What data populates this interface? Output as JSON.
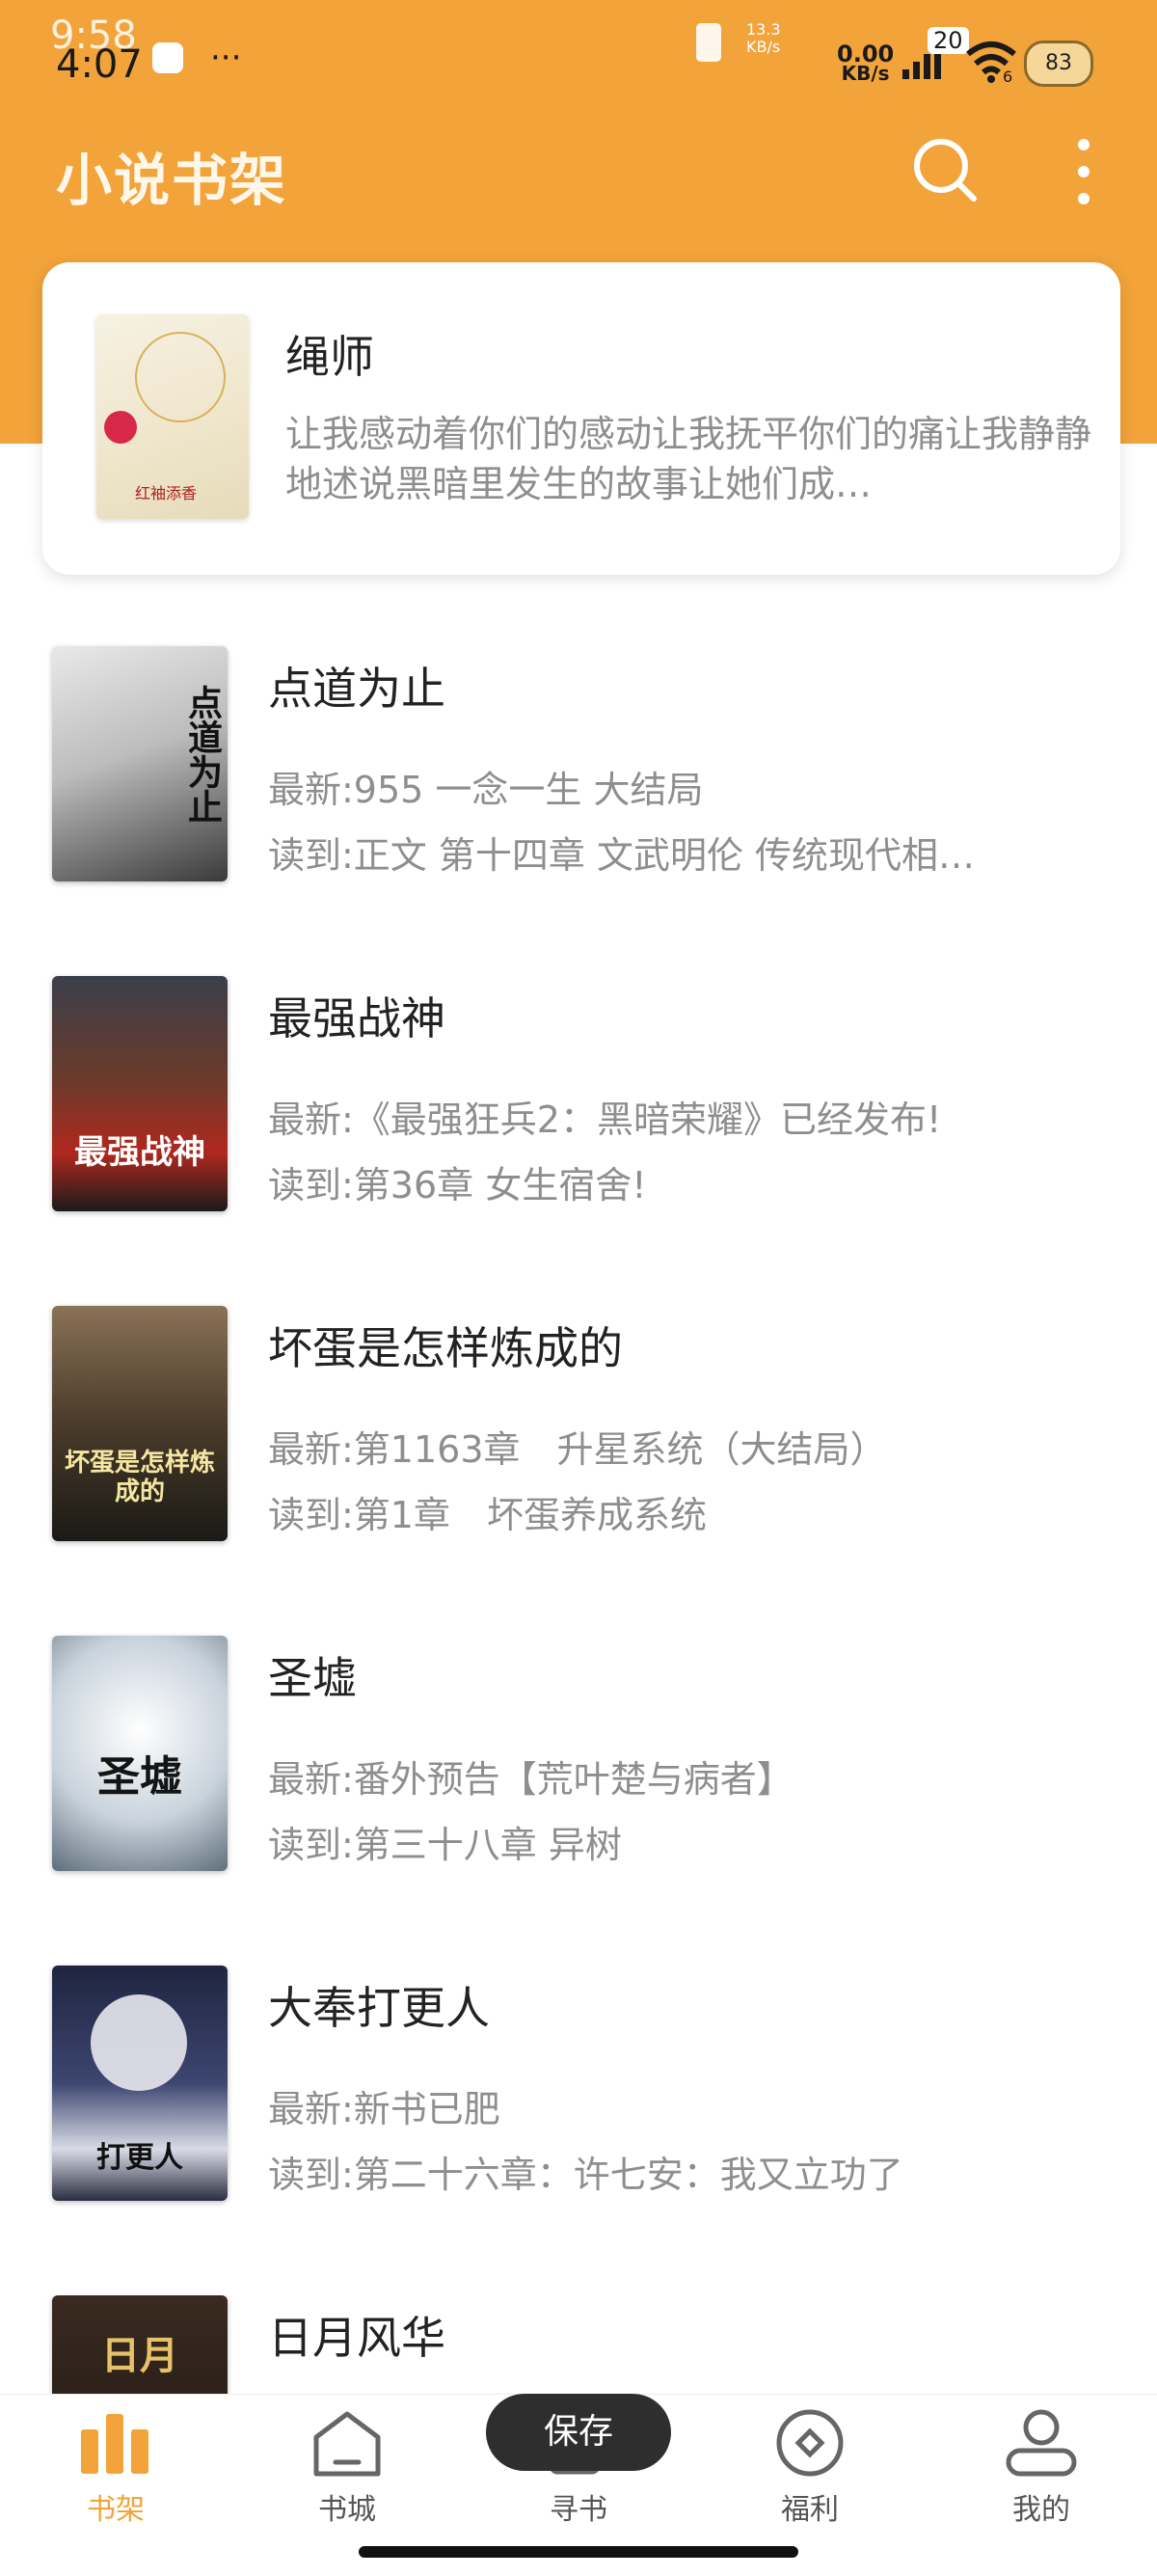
{
  "status_bar": {
    "time_back": "9:58",
    "time_front": "4:07",
    "dots": "···",
    "net_speed": "0.00",
    "net_unit": "KB/s",
    "net_speed_2": "13.3",
    "net_unit_2": "KB/s",
    "signal_badge": "20",
    "wifi_sub": "6",
    "battery": "83"
  },
  "header": {
    "title": "小说书架"
  },
  "featured": {
    "title": "绳师",
    "description": "让我感动着你们的感动让我抚平你们的痛让我静静地述说黑暗里发生的故事让她们成…",
    "cover_text": "红袖添香"
  },
  "books": [
    {
      "title": "点道为止",
      "latest": "最新:955 一念一生 大结局",
      "read": "读到:正文 第十四章 文武明伦 传统现代相…",
      "cover_text": "点道为止"
    },
    {
      "title": "最强战神",
      "latest": "最新:《最强狂兵2：黑暗荣耀》已经发布!",
      "read": "读到:第36章 女生宿舍!",
      "cover_text": "最强战神"
    },
    {
      "title": "坏蛋是怎样炼成的",
      "latest": "最新:第1163章　升星系统（大结局）",
      "read": "读到:第1章　坏蛋养成系统",
      "cover_text": "坏蛋是怎样炼成的"
    },
    {
      "title": "圣墟",
      "latest": "最新:番外预告【荒叶楚与病者】",
      "read": "读到:第三十八章 异树",
      "cover_text": "圣墟"
    },
    {
      "title": "大奉打更人",
      "latest": "最新:新书已肥",
      "read": "读到:第二十六章：许七安：我又立功了",
      "cover_text": "打更人"
    },
    {
      "title": "日月风华",
      "latest": "",
      "read": "",
      "cover_text": "日月"
    }
  ],
  "nav": [
    {
      "label": "书架",
      "icon": "bookshelf-icon"
    },
    {
      "label": "书城",
      "icon": "bookstore-icon"
    },
    {
      "label": "寻书",
      "icon": "find-book-icon"
    },
    {
      "label": "福利",
      "icon": "welfare-icon"
    },
    {
      "label": "我的",
      "icon": "profile-icon"
    }
  ],
  "toast": "保存",
  "colors": {
    "accent": "#F2A33A"
  }
}
